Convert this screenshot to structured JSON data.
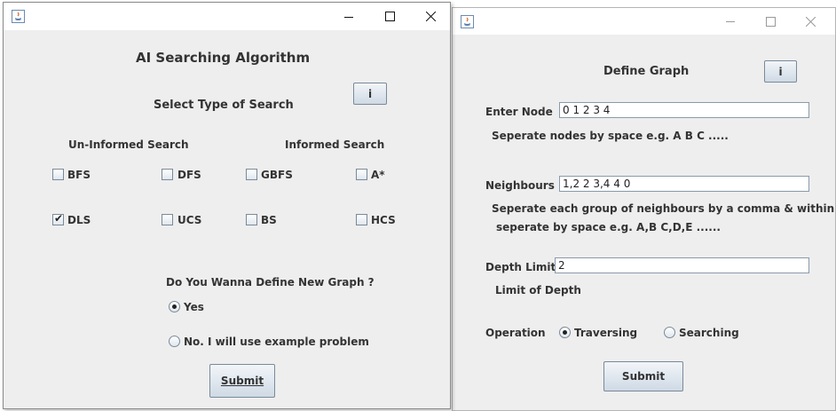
{
  "left_window": {
    "heading": "AI Searching Algorithm",
    "select_type": "Select Type of Search",
    "info_button": "i",
    "uninformed_label": "Un-Informed Search",
    "informed_label": "Informed Search",
    "checkboxes": [
      {
        "label": "BFS",
        "checked": false
      },
      {
        "label": "DFS",
        "checked": false
      },
      {
        "label": "GBFS",
        "checked": false
      },
      {
        "label": "A*",
        "checked": false
      },
      {
        "label": "DLS",
        "checked": true
      },
      {
        "label": "UCS",
        "checked": false
      },
      {
        "label": "BS",
        "checked": false
      },
      {
        "label": "HCS",
        "checked": false
      }
    ],
    "define_question": "Do You Wanna Define New Graph ?",
    "radio_yes": "Yes",
    "radio_no": "No. I will use example problem",
    "radio_selected": "yes",
    "submit": "Submit"
  },
  "right_window": {
    "heading": "Define Graph",
    "info_button": "i",
    "enter_node_label": "Enter Node",
    "enter_node_value": "0 1 2 3 4",
    "node_hint": "Seperate nodes by space e.g. A B C .....",
    "neighbours_label": "Neighbours",
    "neighbours_value": "1,2 2 3,4 4 0",
    "neighbours_hint_1": "Seperate each group of neighbours by a comma & within group",
    "neighbours_hint_2": "seperate by space e.g. A,B C,D,E ......",
    "depth_label": "Depth Limit",
    "depth_value": "2",
    "depth_hint": "Limit of Depth",
    "operation_label": "Operation",
    "radio_traversing": "Traversing",
    "radio_searching": "Searching",
    "radio_selected": "traversing",
    "submit": "Submit"
  }
}
